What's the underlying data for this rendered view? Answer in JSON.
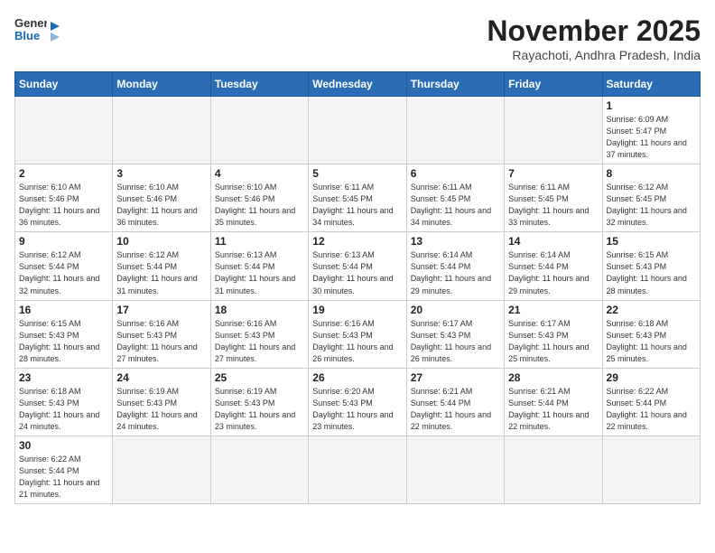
{
  "header": {
    "logo_general": "General",
    "logo_blue": "Blue",
    "month_title": "November 2025",
    "subtitle": "Rayachoti, Andhra Pradesh, India"
  },
  "weekdays": [
    "Sunday",
    "Monday",
    "Tuesday",
    "Wednesday",
    "Thursday",
    "Friday",
    "Saturday"
  ],
  "weeks": [
    [
      {
        "day": null
      },
      {
        "day": null
      },
      {
        "day": null
      },
      {
        "day": null
      },
      {
        "day": null
      },
      {
        "day": null
      },
      {
        "day": 1,
        "sunrise": "Sunrise: 6:09 AM",
        "sunset": "Sunset: 5:47 PM",
        "daylight": "Daylight: 11 hours and 37 minutes."
      }
    ],
    [
      {
        "day": 2,
        "sunrise": "Sunrise: 6:10 AM",
        "sunset": "Sunset: 5:46 PM",
        "daylight": "Daylight: 11 hours and 36 minutes."
      },
      {
        "day": 3,
        "sunrise": "Sunrise: 6:10 AM",
        "sunset": "Sunset: 5:46 PM",
        "daylight": "Daylight: 11 hours and 36 minutes."
      },
      {
        "day": 4,
        "sunrise": "Sunrise: 6:10 AM",
        "sunset": "Sunset: 5:46 PM",
        "daylight": "Daylight: 11 hours and 35 minutes."
      },
      {
        "day": 5,
        "sunrise": "Sunrise: 6:11 AM",
        "sunset": "Sunset: 5:45 PM",
        "daylight": "Daylight: 11 hours and 34 minutes."
      },
      {
        "day": 6,
        "sunrise": "Sunrise: 6:11 AM",
        "sunset": "Sunset: 5:45 PM",
        "daylight": "Daylight: 11 hours and 34 minutes."
      },
      {
        "day": 7,
        "sunrise": "Sunrise: 6:11 AM",
        "sunset": "Sunset: 5:45 PM",
        "daylight": "Daylight: 11 hours and 33 minutes."
      },
      {
        "day": 8,
        "sunrise": "Sunrise: 6:12 AM",
        "sunset": "Sunset: 5:45 PM",
        "daylight": "Daylight: 11 hours and 32 minutes."
      }
    ],
    [
      {
        "day": 9,
        "sunrise": "Sunrise: 6:12 AM",
        "sunset": "Sunset: 5:44 PM",
        "daylight": "Daylight: 11 hours and 32 minutes."
      },
      {
        "day": 10,
        "sunrise": "Sunrise: 6:12 AM",
        "sunset": "Sunset: 5:44 PM",
        "daylight": "Daylight: 11 hours and 31 minutes."
      },
      {
        "day": 11,
        "sunrise": "Sunrise: 6:13 AM",
        "sunset": "Sunset: 5:44 PM",
        "daylight": "Daylight: 11 hours and 31 minutes."
      },
      {
        "day": 12,
        "sunrise": "Sunrise: 6:13 AM",
        "sunset": "Sunset: 5:44 PM",
        "daylight": "Daylight: 11 hours and 30 minutes."
      },
      {
        "day": 13,
        "sunrise": "Sunrise: 6:14 AM",
        "sunset": "Sunset: 5:44 PM",
        "daylight": "Daylight: 11 hours and 29 minutes."
      },
      {
        "day": 14,
        "sunrise": "Sunrise: 6:14 AM",
        "sunset": "Sunset: 5:44 PM",
        "daylight": "Daylight: 11 hours and 29 minutes."
      },
      {
        "day": 15,
        "sunrise": "Sunrise: 6:15 AM",
        "sunset": "Sunset: 5:43 PM",
        "daylight": "Daylight: 11 hours and 28 minutes."
      }
    ],
    [
      {
        "day": 16,
        "sunrise": "Sunrise: 6:15 AM",
        "sunset": "Sunset: 5:43 PM",
        "daylight": "Daylight: 11 hours and 28 minutes."
      },
      {
        "day": 17,
        "sunrise": "Sunrise: 6:16 AM",
        "sunset": "Sunset: 5:43 PM",
        "daylight": "Daylight: 11 hours and 27 minutes."
      },
      {
        "day": 18,
        "sunrise": "Sunrise: 6:16 AM",
        "sunset": "Sunset: 5:43 PM",
        "daylight": "Daylight: 11 hours and 27 minutes."
      },
      {
        "day": 19,
        "sunrise": "Sunrise: 6:16 AM",
        "sunset": "Sunset: 5:43 PM",
        "daylight": "Daylight: 11 hours and 26 minutes."
      },
      {
        "day": 20,
        "sunrise": "Sunrise: 6:17 AM",
        "sunset": "Sunset: 5:43 PM",
        "daylight": "Daylight: 11 hours and 26 minutes."
      },
      {
        "day": 21,
        "sunrise": "Sunrise: 6:17 AM",
        "sunset": "Sunset: 5:43 PM",
        "daylight": "Daylight: 11 hours and 25 minutes."
      },
      {
        "day": 22,
        "sunrise": "Sunrise: 6:18 AM",
        "sunset": "Sunset: 5:43 PM",
        "daylight": "Daylight: 11 hours and 25 minutes."
      }
    ],
    [
      {
        "day": 23,
        "sunrise": "Sunrise: 6:18 AM",
        "sunset": "Sunset: 5:43 PM",
        "daylight": "Daylight: 11 hours and 24 minutes."
      },
      {
        "day": 24,
        "sunrise": "Sunrise: 6:19 AM",
        "sunset": "Sunset: 5:43 PM",
        "daylight": "Daylight: 11 hours and 24 minutes."
      },
      {
        "day": 25,
        "sunrise": "Sunrise: 6:19 AM",
        "sunset": "Sunset: 5:43 PM",
        "daylight": "Daylight: 11 hours and 23 minutes."
      },
      {
        "day": 26,
        "sunrise": "Sunrise: 6:20 AM",
        "sunset": "Sunset: 5:43 PM",
        "daylight": "Daylight: 11 hours and 23 minutes."
      },
      {
        "day": 27,
        "sunrise": "Sunrise: 6:21 AM",
        "sunset": "Sunset: 5:44 PM",
        "daylight": "Daylight: 11 hours and 22 minutes."
      },
      {
        "day": 28,
        "sunrise": "Sunrise: 6:21 AM",
        "sunset": "Sunset: 5:44 PM",
        "daylight": "Daylight: 11 hours and 22 minutes."
      },
      {
        "day": 29,
        "sunrise": "Sunrise: 6:22 AM",
        "sunset": "Sunset: 5:44 PM",
        "daylight": "Daylight: 11 hours and 22 minutes."
      }
    ],
    [
      {
        "day": 30,
        "sunrise": "Sunrise: 6:22 AM",
        "sunset": "Sunset: 5:44 PM",
        "daylight": "Daylight: 11 hours and 21 minutes."
      },
      {
        "day": null
      },
      {
        "day": null
      },
      {
        "day": null
      },
      {
        "day": null
      },
      {
        "day": null
      },
      {
        "day": null
      }
    ]
  ]
}
